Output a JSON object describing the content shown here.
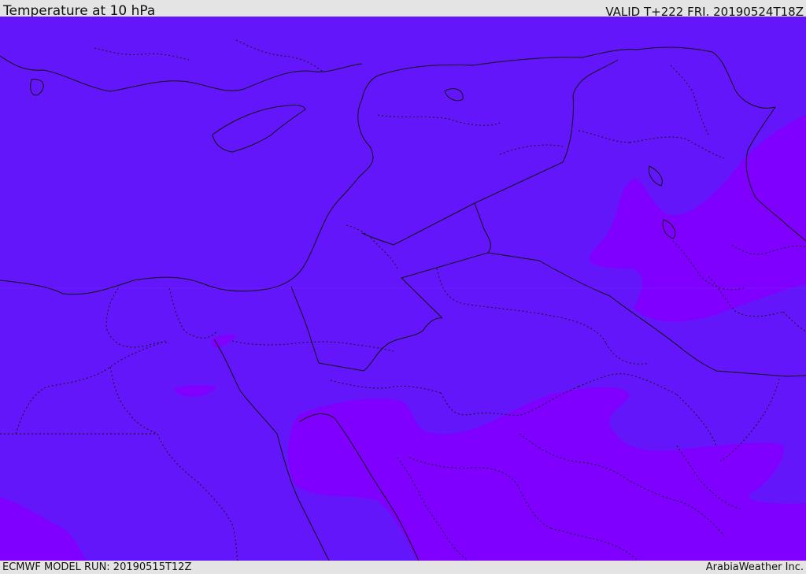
{
  "header": {
    "title": "Temperature at 10 hPa",
    "valid": "VALID T+222 FRI. 20190524T18Z"
  },
  "footer": {
    "model_run": "ECMWF MODEL RUN: 20190515T12Z",
    "credit": "ArabiaWeather Inc."
  },
  "map": {
    "colors": {
      "base_field": "#6416fb",
      "warm_field": "#8000ff",
      "border_line": "#111111"
    }
  }
}
